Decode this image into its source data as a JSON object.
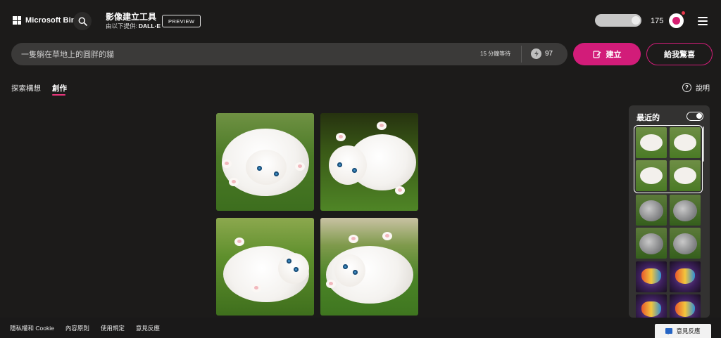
{
  "header": {
    "brand": "Microsoft Bing",
    "app_title": "影像建立工具",
    "provider_prefix": "由以下提供:",
    "provider_name": "DALL·E",
    "preview_badge": "PREVIEW",
    "reward_count": "175"
  },
  "prompt": {
    "value": "一隻躺在草地上的圓胖的貓",
    "wait_text": "15 分鐘等待",
    "boost_count": "97",
    "create_label": "建立",
    "surprise_label": "給我驚喜"
  },
  "tabs": [
    {
      "label": "探索構想",
      "active": false
    },
    {
      "label": "創作",
      "active": true
    }
  ],
  "help_label": "說明",
  "recent": {
    "title": "最近的"
  },
  "footer": {
    "links": [
      "隱私權和 Cookie",
      "內容原則",
      "使用規定",
      "意見反應"
    ],
    "feedback_label": "意見反應"
  },
  "colors": {
    "accent": "#d21c79",
    "background": "#1c1b1a",
    "prompt_bar": "#3b3a39",
    "panel": "#333231"
  },
  "icons": {
    "search": "search-icon",
    "reward": "trophy-icon",
    "menu": "hamburger-menu-icon",
    "boost": "boost-coin-icon",
    "create": "create-edit-icon",
    "help": "help-icon",
    "toggle": "toggle-switch-icon",
    "feedback": "feedback-chat-icon"
  }
}
